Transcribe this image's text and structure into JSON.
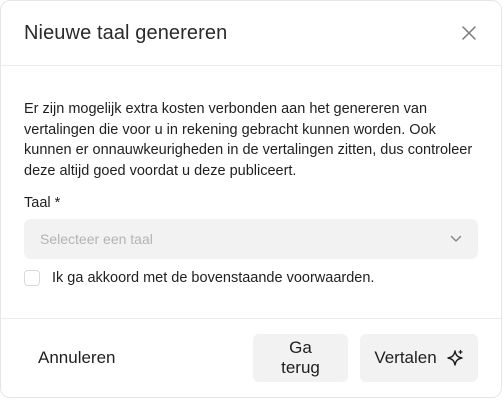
{
  "dialog": {
    "title": "Nieuwe taal genereren",
    "close_icon": "close-icon",
    "description": "Er zijn mogelijk extra kosten verbonden aan het genereren van vertalingen die voor u in rekening gebracht kunnen worden. Ook kunnen er onnauwkeurigheden in de vertalingen zitten, dus controleer deze altijd goed voordat u deze publiceert.",
    "language_label": "Taal *",
    "language_select": {
      "placeholder": "Selecteer een taal",
      "icon": "chevron-down-icon"
    },
    "agreement": {
      "label": "Ik ga akkoord met de bovenstaande voorwaarden.",
      "checked": false
    },
    "footer": {
      "cancel_label": "Annuleren",
      "back_label": "Ga terug",
      "translate_label": "Vertalen",
      "translate_icon": "sparkle-icon"
    }
  },
  "colors": {
    "field_bg": "#f2f2f3",
    "border": "#ececec",
    "text": "#1f1f1f",
    "placeholder": "#b3b3b6"
  }
}
